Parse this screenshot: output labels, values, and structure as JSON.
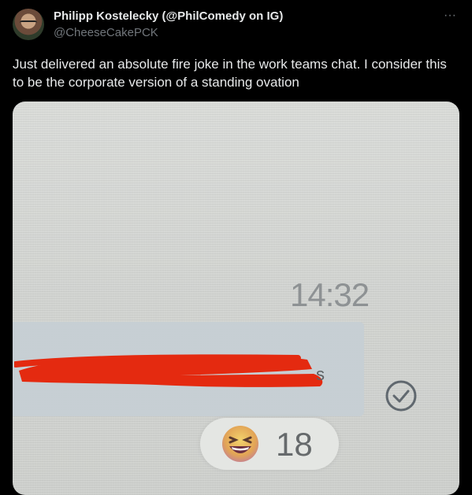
{
  "author": {
    "name": "Philipp Kostelecky (@PhilComedy on IG)",
    "handle": "@CheeseCakePCK",
    "avatar_icon": "profile-photo"
  },
  "more_icon": "ellipsis-icon",
  "tweet": {
    "text": "Just delivered an absolute fire joke in the work teams chat. I consider this to be the corporate version of a standing ovation"
  },
  "photo": {
    "timestamp": "14:32",
    "message_text": "s",
    "reaction_emoji": "laughing-face",
    "reaction_count": "18"
  },
  "colors": {
    "background": "#000000",
    "text_primary": "#e7e9ea",
    "text_secondary": "#71767b",
    "redaction": "#e42a10"
  }
}
